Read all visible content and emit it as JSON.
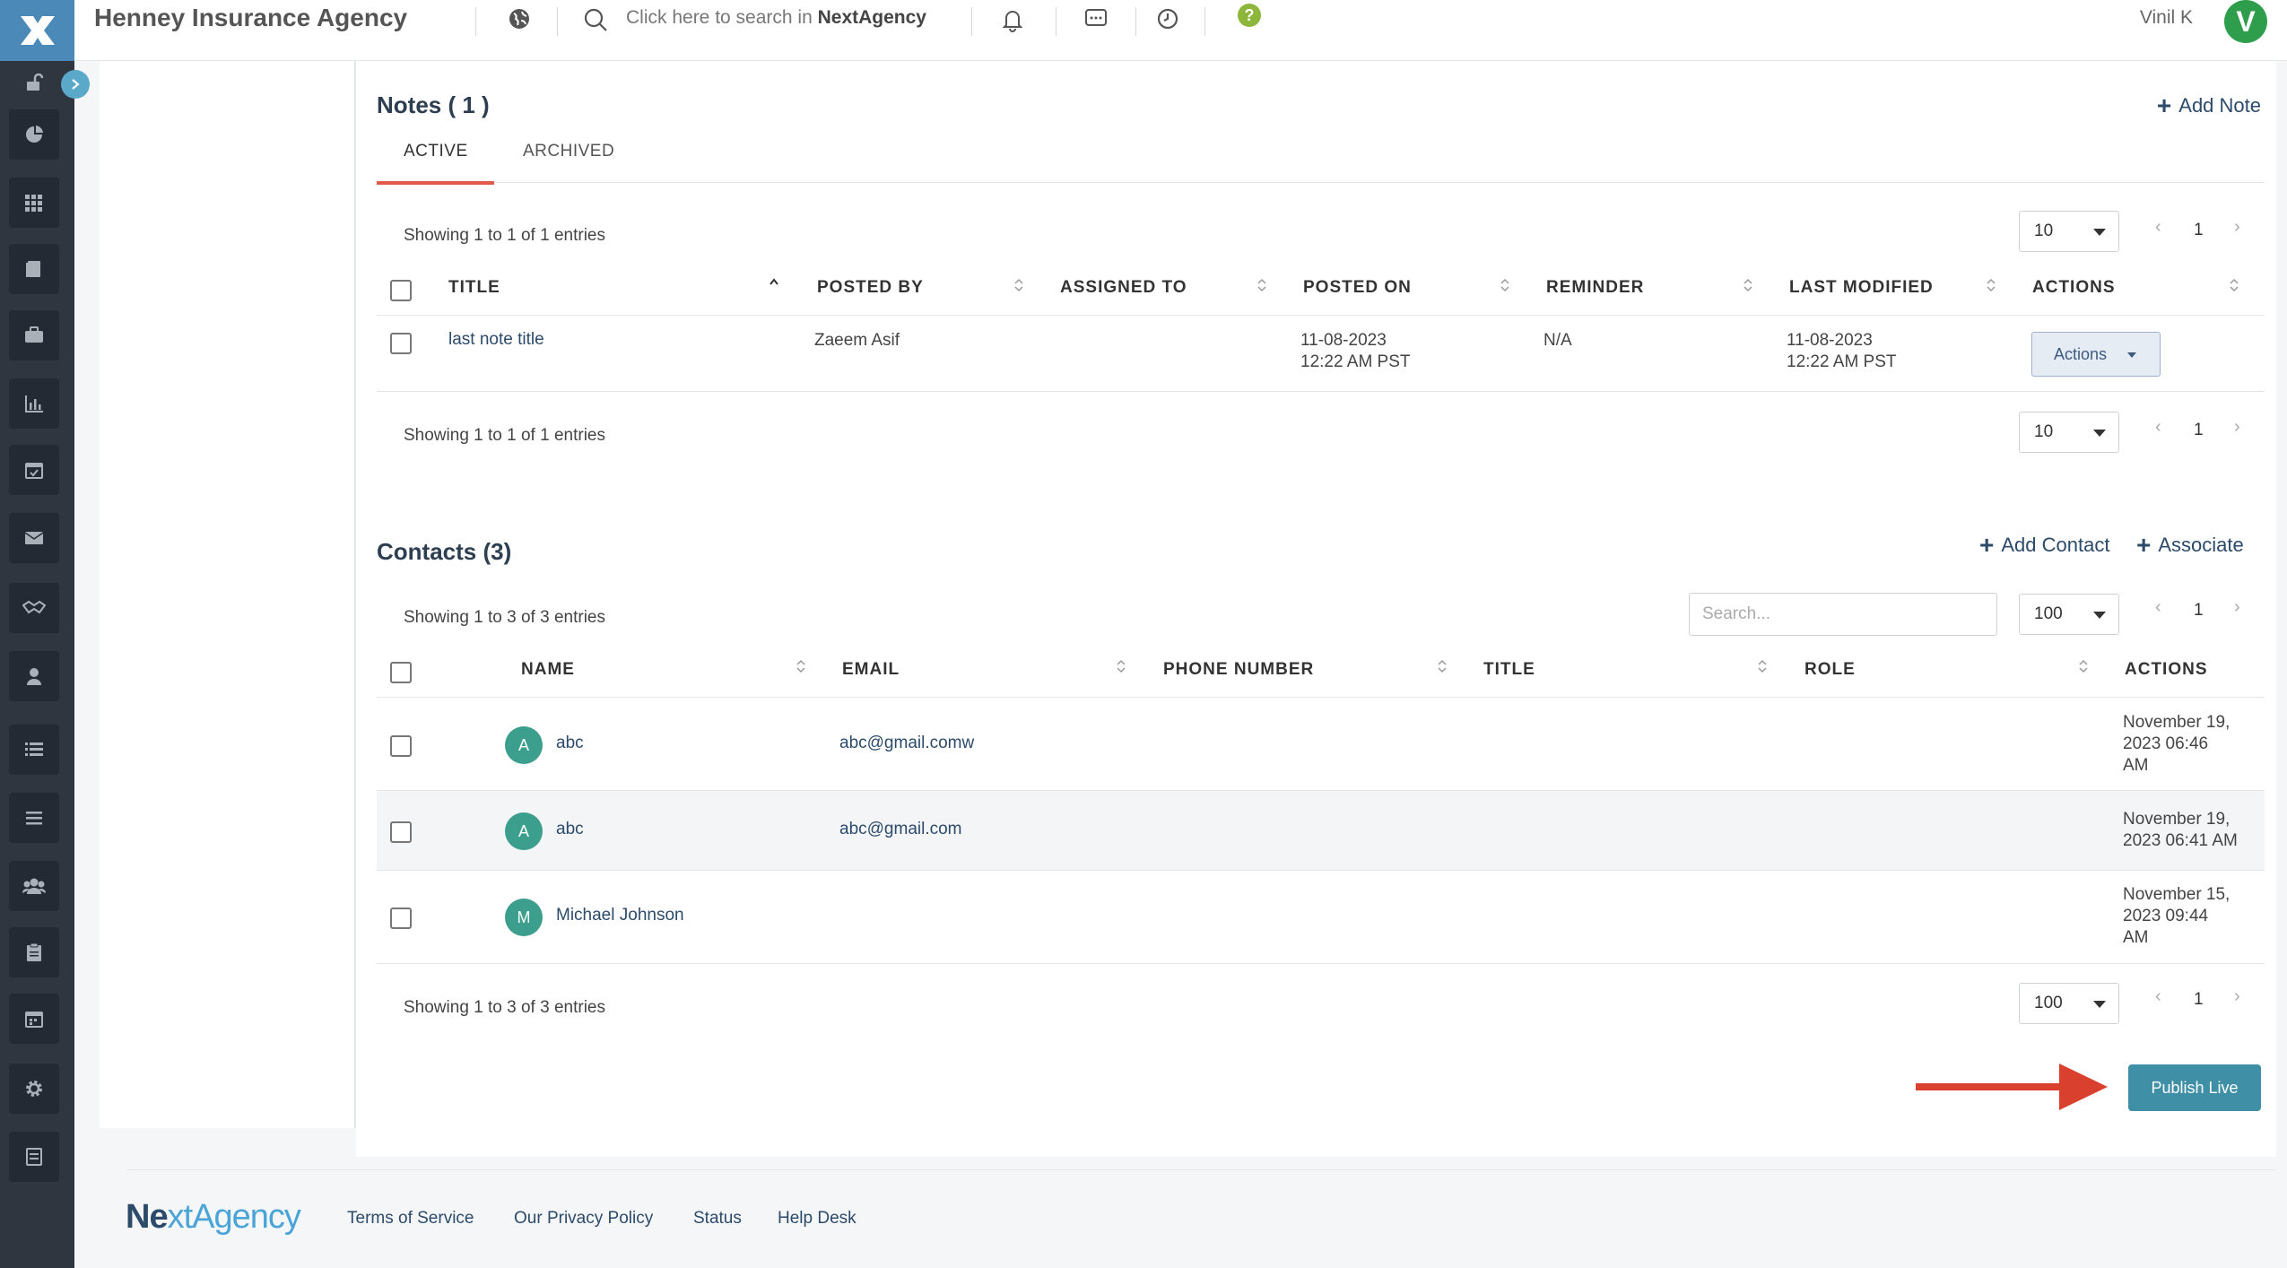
{
  "header": {
    "agency_name": "Henney Insurance Agency",
    "search_prefix": "Click here to search in ",
    "search_brand": "NextAgency",
    "user_name": "Vinil K",
    "user_initial": "V"
  },
  "sidebar": {
    "icons": [
      "unlock-icon",
      "pie-chart-icon",
      "grid-icon",
      "book-icon",
      "briefcase-icon",
      "bar-chart-icon",
      "calendar-check-icon",
      "envelope-icon",
      "handshake-icon",
      "user-icon",
      "list-icon",
      "align-icon",
      "users-icon",
      "clipboard-icon",
      "calendar-icon",
      "gear-icon",
      "report-icon"
    ]
  },
  "notes": {
    "title": "Notes ( 1 )",
    "add_label": "Add Note",
    "tabs": [
      "ACTIVE",
      "ARCHIVED"
    ],
    "active_tab": "ACTIVE",
    "showing_top": "Showing 1 to 1 of 1 entries",
    "showing_bottom": "Showing 1 to 1 of 1 entries",
    "page_length": "10",
    "page": "1",
    "columns": [
      "TITLE",
      "POSTED BY",
      "ASSIGNED TO",
      "POSTED ON",
      "REMINDER",
      "LAST MODIFIED",
      "ACTIONS"
    ],
    "rows": [
      {
        "title": "last note title",
        "posted_by": "Zaeem Asif",
        "assigned_to": "",
        "posted_on_date": "11-08-2023",
        "posted_on_time": "12:22 AM PST",
        "reminder": "N/A",
        "modified_date": "11-08-2023",
        "modified_time": "12:22 AM PST",
        "actions_label": "Actions"
      }
    ]
  },
  "contacts": {
    "title": "Contacts (3)",
    "add_label": "Add Contact",
    "associate_label": "Associate",
    "showing_top": "Showing 1 to 3 of 3 entries",
    "showing_bottom": "Showing 1 to 3 of 3 entries",
    "search_placeholder": "Search...",
    "page_length": "100",
    "page": "1",
    "columns": [
      "NAME",
      "EMAIL",
      "PHONE NUMBER",
      "TITLE",
      "ROLE",
      "ACTIONS"
    ],
    "rows": [
      {
        "initial": "A",
        "name": "abc",
        "email": "abc@gmail.comw",
        "action_l1": "November 19,",
        "action_l2": "2023 06:46",
        "action_l3": "AM"
      },
      {
        "initial": "A",
        "name": "abc",
        "email": "abc@gmail.com",
        "action_l1": "November 19,",
        "action_l2": "2023 06:41 AM",
        "action_l3": ""
      },
      {
        "initial": "M",
        "name": "Michael Johnson",
        "email": "",
        "action_l1": "November 15,",
        "action_l2": "2023 09:44",
        "action_l3": "AM"
      }
    ]
  },
  "publish_label": "Publish Live",
  "footer": {
    "logo_part1": "Ne",
    "logo_part2": "xt",
    "logo_part3": "Agency",
    "links": [
      "Terms of Service",
      "Our Privacy Policy",
      "Status",
      "Help Desk"
    ]
  },
  "colors": {
    "sidebar_bg": "#2f3640",
    "accent_red": "#e25a4a",
    "brand_blue": "#2c4a6a",
    "publish_button": "#3f8fa6",
    "avatar_green": "#2e9d4c",
    "contact_avatar": "#3c9f8e"
  }
}
